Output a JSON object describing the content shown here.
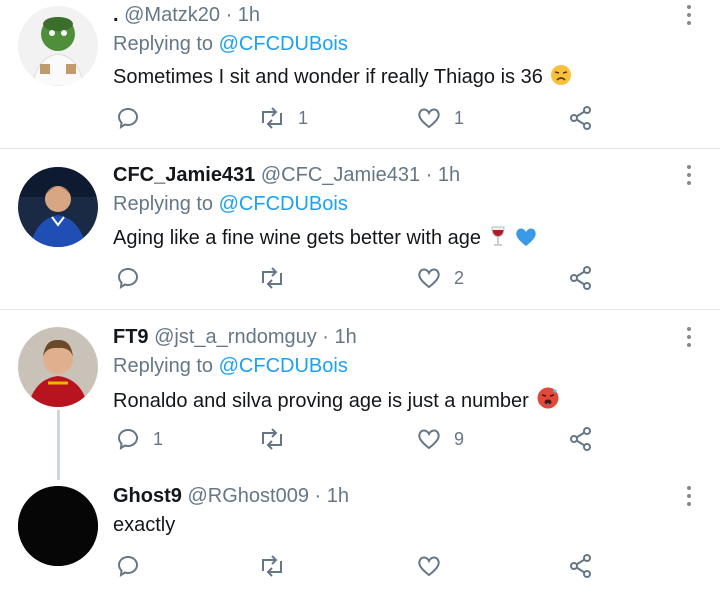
{
  "tweets": [
    {
      "display_name": ".",
      "handle": "@Matzk20",
      "time": "· 1h",
      "replying_prefix": "Replying to",
      "replying_to": "@CFCDUBois",
      "text": "Sometimes I sit and wonder if really Thiago is 36",
      "emoji": "disappointed-face-emoji",
      "reply_count": "",
      "retweet_count": "1",
      "like_count": "1"
    },
    {
      "display_name": "CFC_Jamie431",
      "handle": "@CFC_Jamie431",
      "time": "· 1h",
      "replying_prefix": "Replying to",
      "replying_to": "@CFCDUBois",
      "text": "Aging like a fine wine gets better with age",
      "emoji": "wine-glass-emoji blue-heart-emoji",
      "reply_count": "",
      "retweet_count": "",
      "like_count": "2"
    },
    {
      "display_name": "FT9",
      "handle": "@jst_a_rndomguy",
      "time": "· 1h",
      "replying_prefix": "Replying to",
      "replying_to": "@CFCDUBois",
      "text": "Ronaldo and silva proving age is just a number",
      "emoji": "hot-face-emoji",
      "reply_count": "1",
      "retweet_count": "",
      "like_count": "9"
    },
    {
      "display_name": "Ghost9",
      "handle": "@RGhost009",
      "time": "· 1h",
      "text": "exactly",
      "reply_count": "",
      "retweet_count": "",
      "like_count": ""
    }
  ],
  "colors": {
    "link": "#1da1f2",
    "muted": "#657786",
    "divider": "#e1e8ed",
    "text": "#14171a"
  }
}
